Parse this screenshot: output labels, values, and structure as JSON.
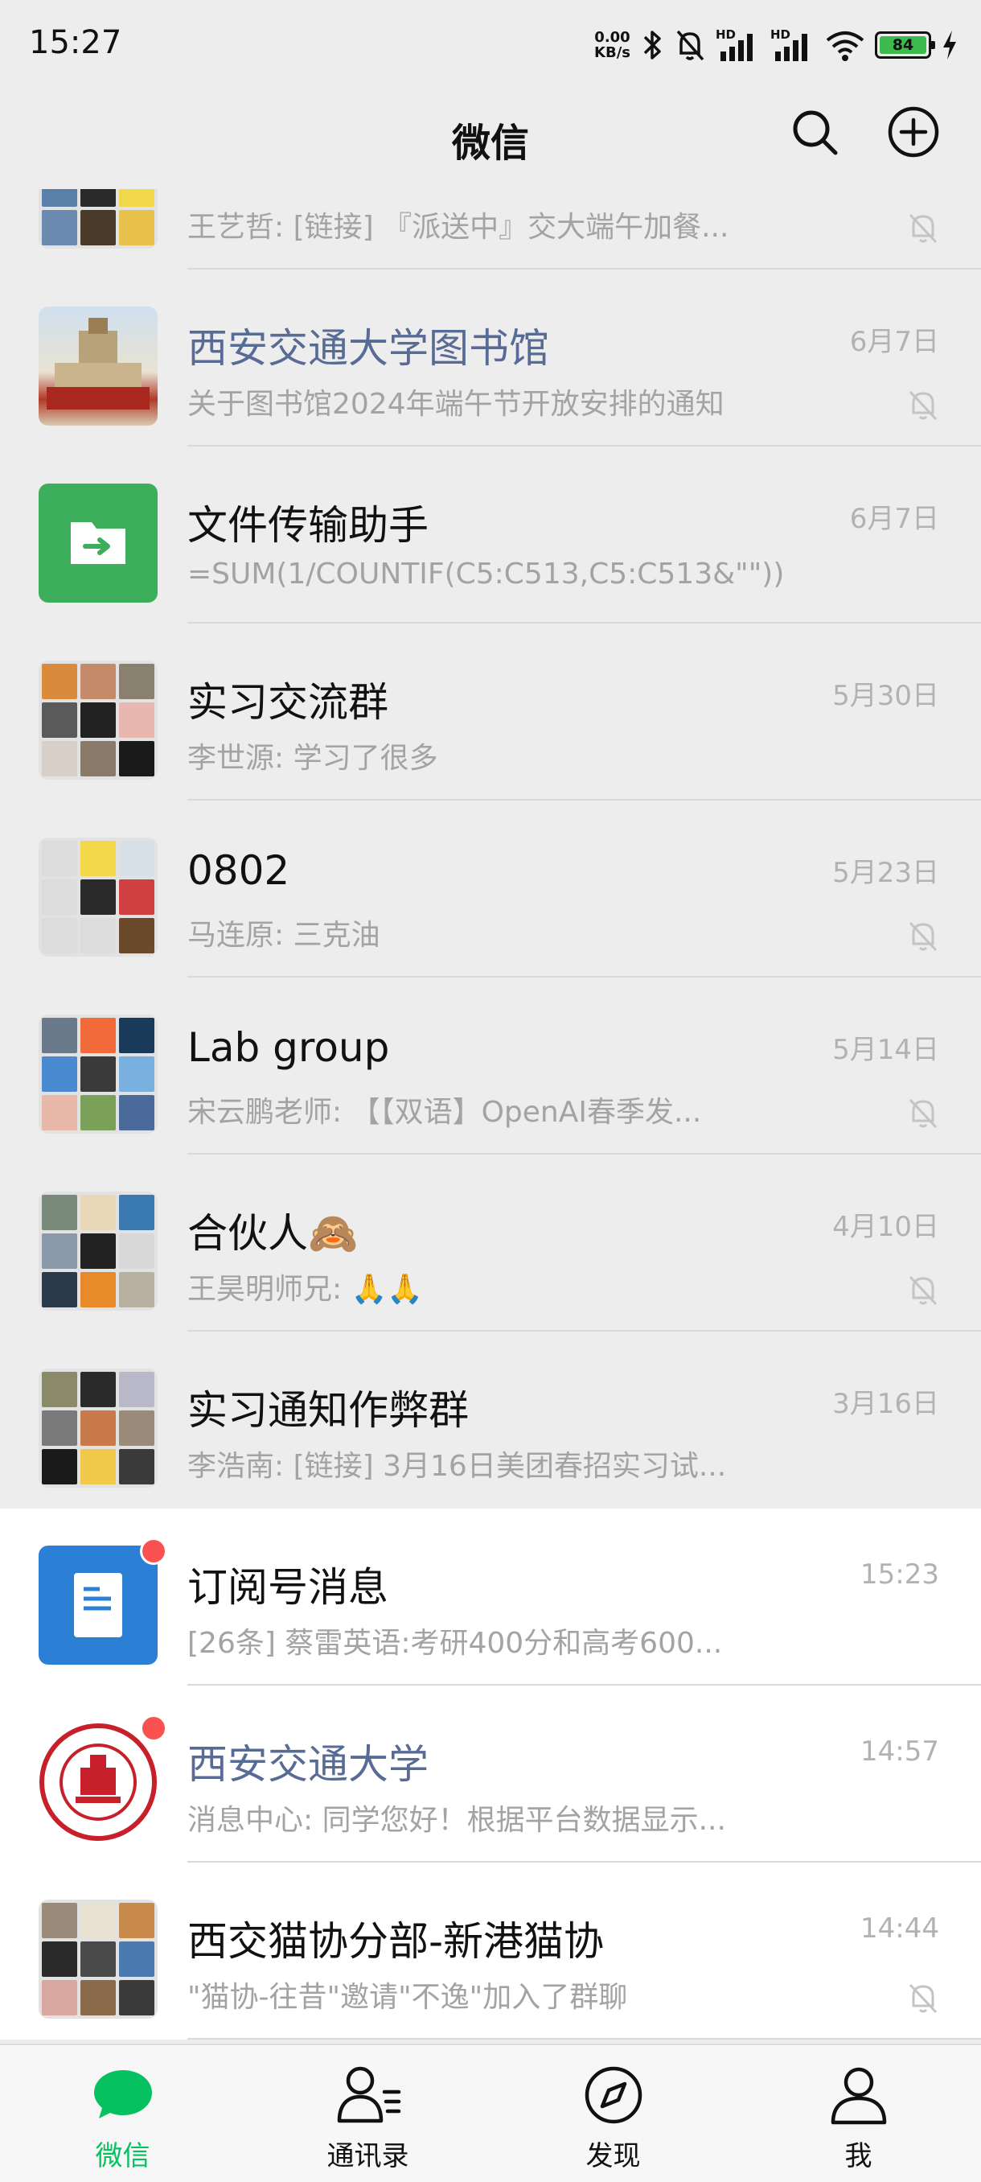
{
  "status_bar": {
    "time": "15:27",
    "net_speed_value": "0.00",
    "net_speed_unit": "KB/s",
    "signal_label_1": "HD",
    "signal_label_2": "HD",
    "battery": "84",
    "icons": [
      "bluetooth-icon",
      "mute-bell-icon",
      "signal-icon",
      "signal-icon",
      "wifi-icon",
      "battery-icon",
      "charging-icon"
    ]
  },
  "header": {
    "title": "微信",
    "icons": [
      "search-icon",
      "add-circle-icon"
    ]
  },
  "chats": [
    {
      "name": "",
      "preview": "王艺哲: [链接] 『派送中』交大端午加餐...",
      "time": "",
      "muted": true,
      "official": false
    },
    {
      "name": "西安交通大学图书馆",
      "preview": "关于图书馆2024年端午节开放安排的通知",
      "time": "6月7日",
      "muted": true,
      "official": true
    },
    {
      "name": "文件传输助手",
      "preview": "=SUM(1/COUNTIF(C5:C513,C5:C513&\"\"))",
      "time": "6月7日",
      "muted": false,
      "official": false
    },
    {
      "name": "实习交流群",
      "preview": "李世源: 学习了很多",
      "time": "5月30日",
      "muted": false,
      "official": false
    },
    {
      "name": "0802",
      "preview": "马连原: 三克油",
      "time": "5月23日",
      "muted": true,
      "official": false
    },
    {
      "name": "Lab group",
      "preview": "宋云鹏老师: 【【双语】OpenAI春季发...",
      "time": "5月14日",
      "muted": true,
      "official": false
    },
    {
      "name": "合伙人🙈",
      "preview": "王昊明师兄: 🙏🙏",
      "time": "4月10日",
      "muted": true,
      "official": false
    },
    {
      "name": "实习通知作弊群",
      "preview": "李浩南: [链接] 3月16日美团春招实习试...",
      "time": "3月16日",
      "muted": false,
      "official": false
    },
    {
      "name": "订阅号消息",
      "preview": "[26条] 蔡雷英语:考研400分和高考600...",
      "time": "15:23",
      "muted": false,
      "official": false
    },
    {
      "name": "西安交通大学",
      "preview": "消息中心: 同学您好！根据平台数据显示...",
      "time": "14:57",
      "muted": false,
      "official": true
    },
    {
      "name": "西交猫协分部-新港猫协",
      "preview": "\"猫协-往昔\"邀请\"不逸\"加入了群聊",
      "time": "14:44",
      "muted": true,
      "official": false
    }
  ],
  "tabs": [
    {
      "label": "微信",
      "icon": "chat-bubble-icon",
      "active": true
    },
    {
      "label": "通讯录",
      "icon": "contacts-icon",
      "active": false
    },
    {
      "label": "发现",
      "icon": "compass-icon",
      "active": false
    },
    {
      "label": "我",
      "icon": "person-icon",
      "active": false
    }
  ],
  "colors": {
    "accent_green": "#07c160",
    "official_blue": "#576b95",
    "badge_red": "#fa5151",
    "pinned_bg": "#ededed"
  }
}
